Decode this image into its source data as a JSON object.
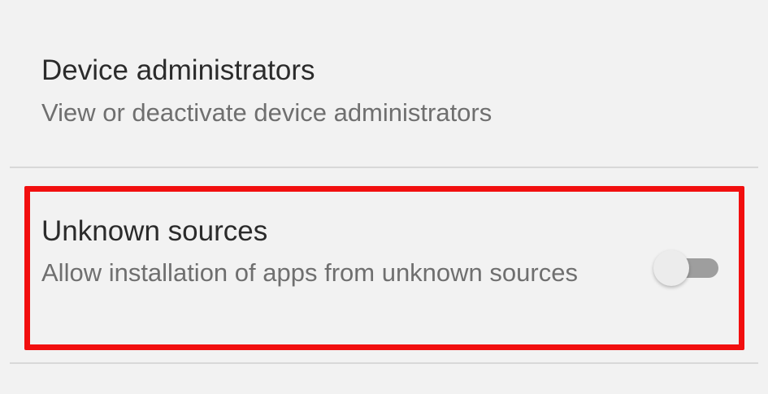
{
  "settings": {
    "items": [
      {
        "title": "Device administrators",
        "summary": "View or deactivate device administrators"
      },
      {
        "title": "Unknown sources",
        "summary": "Allow installation of apps from unknown sources",
        "toggle_on": false
      }
    ]
  },
  "colors": {
    "highlight": "#f20f0f",
    "background": "#f2f2f2",
    "title": "#2b2b2b",
    "summary": "#6f6f6f"
  }
}
